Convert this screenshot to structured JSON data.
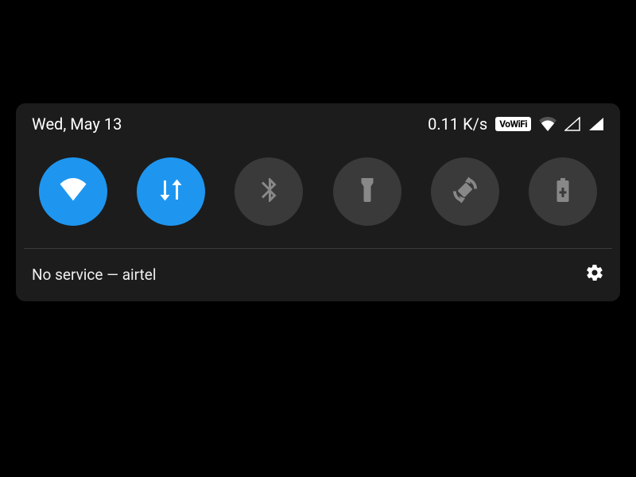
{
  "status": {
    "date": "Wed, May 13",
    "speed": "0.11 K/s",
    "vowifi": "VoWiFi"
  },
  "toggles": {
    "wifi": {
      "name": "wifi",
      "active": true
    },
    "data": {
      "name": "mobile-data",
      "active": true
    },
    "bluetooth": {
      "name": "bluetooth",
      "active": false
    },
    "flashlight": {
      "name": "flashlight",
      "active": false
    },
    "rotate": {
      "name": "auto-rotate",
      "active": false
    },
    "battery": {
      "name": "battery-saver",
      "active": false
    }
  },
  "footer": {
    "carrier": "No service — airtel"
  },
  "colors": {
    "accent": "#1e96f0",
    "panel": "#1c1c1c",
    "inactive": "#3a3a3a"
  }
}
